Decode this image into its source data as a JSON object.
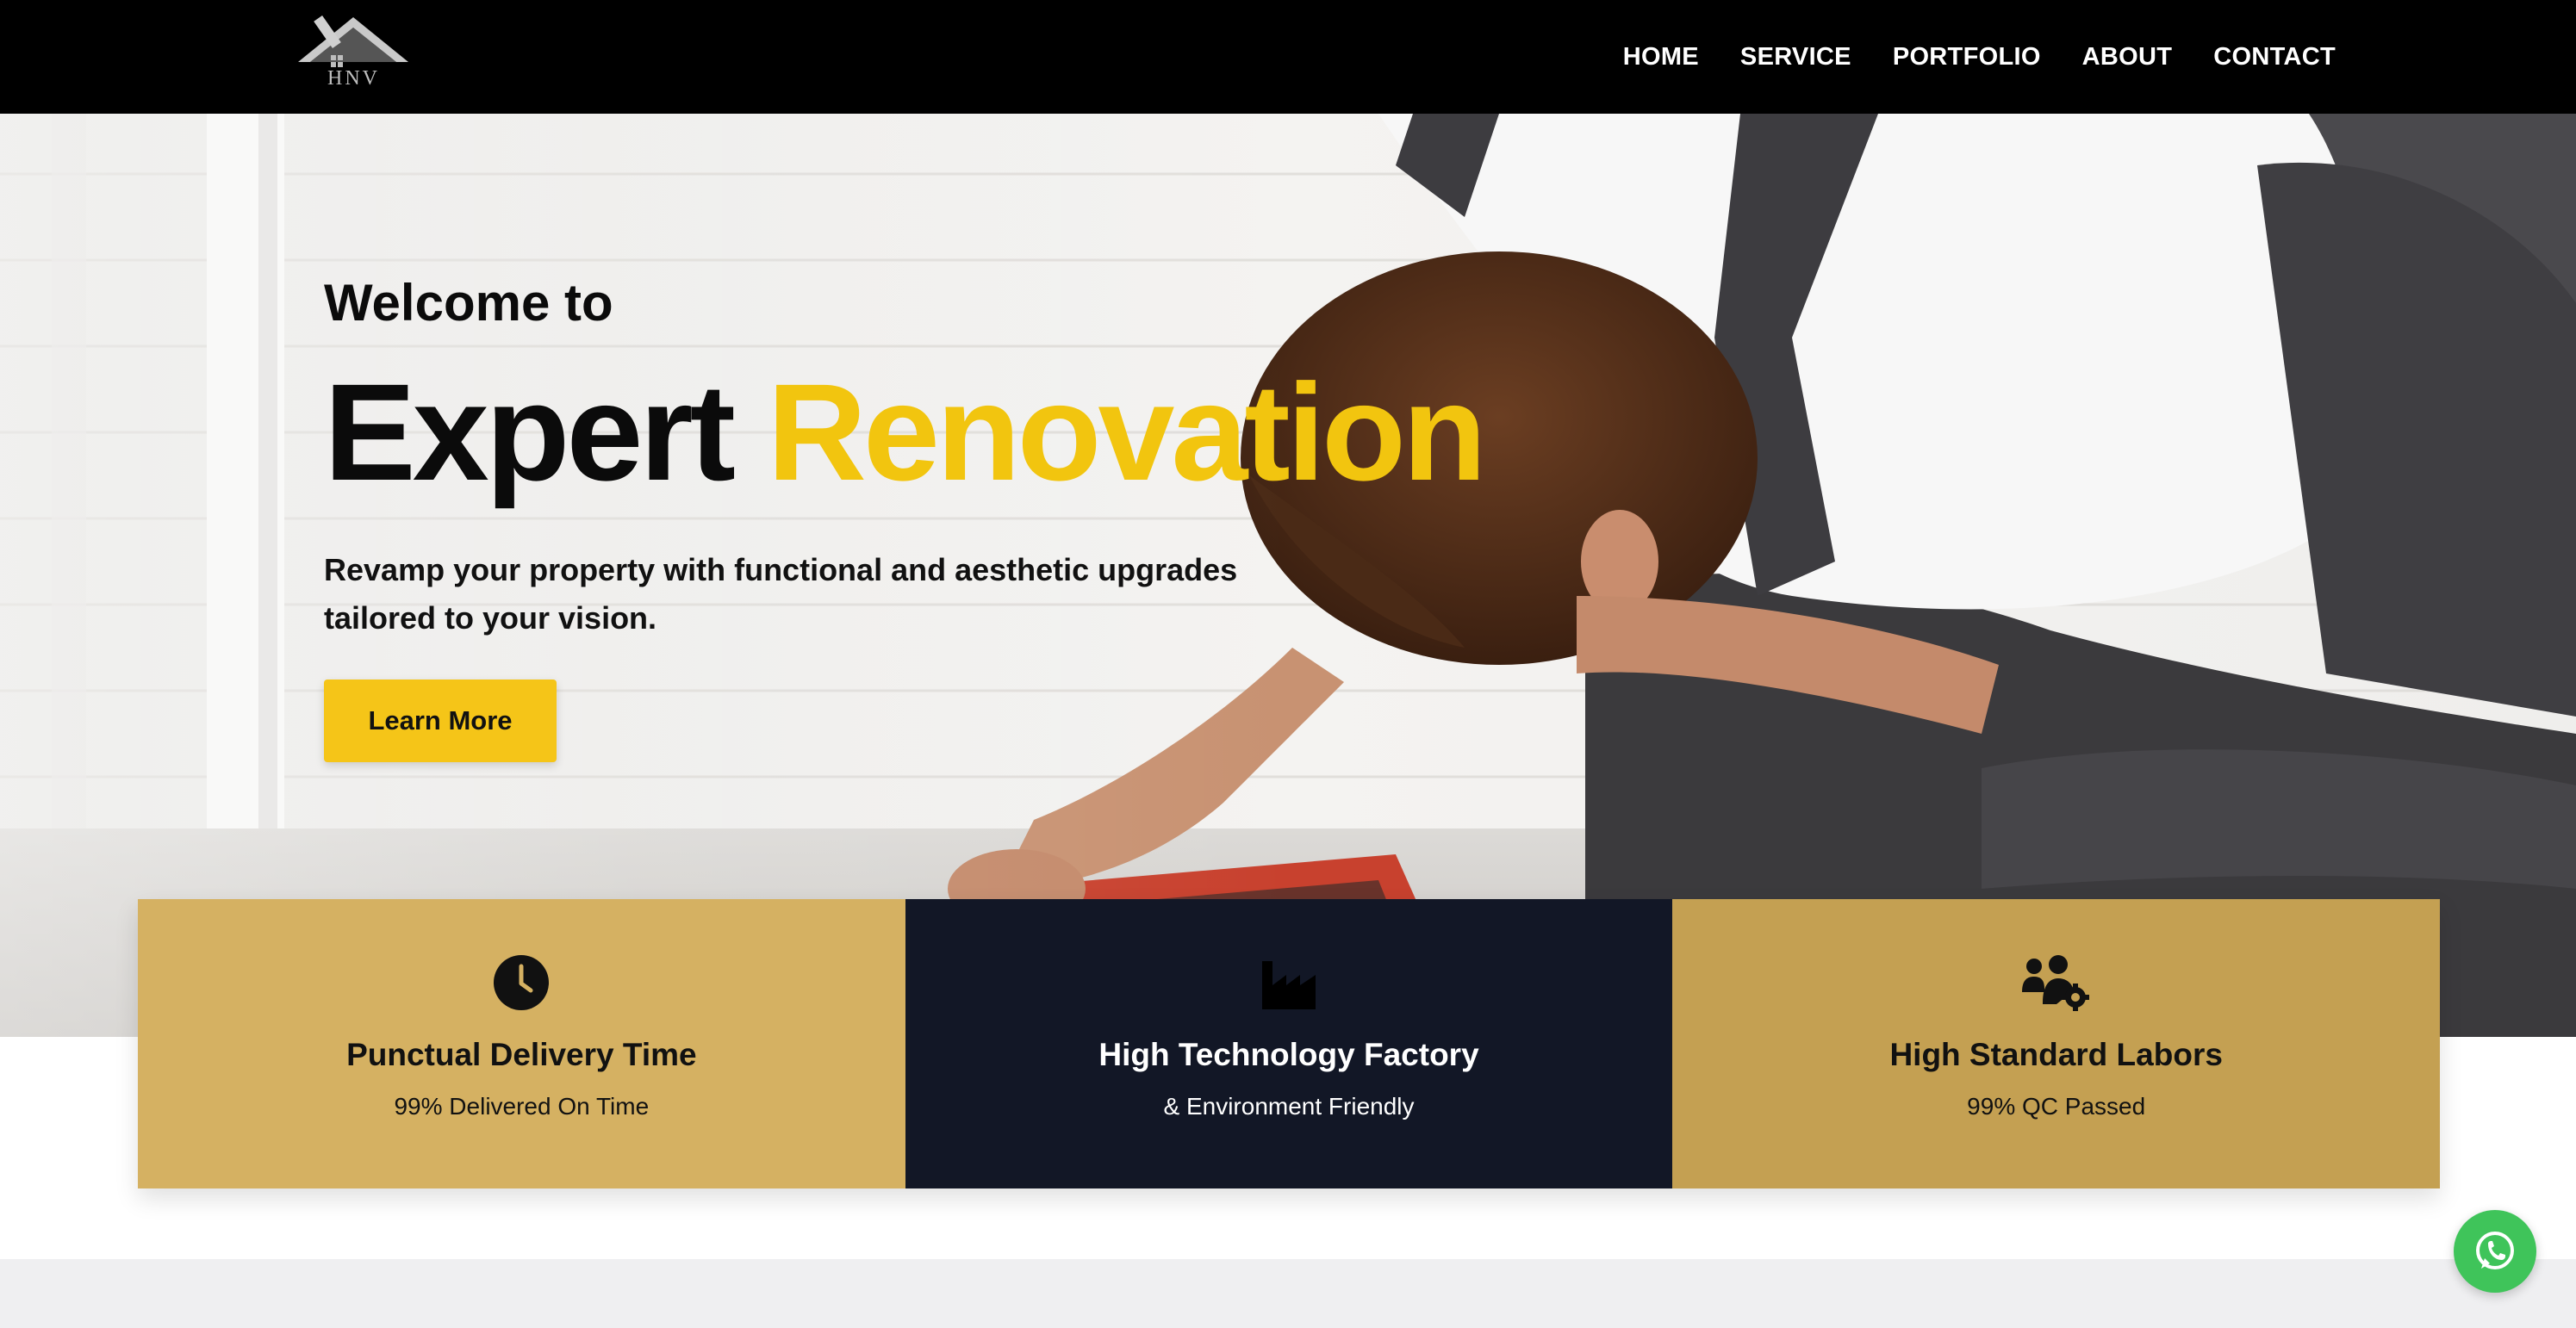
{
  "brand": {
    "logo_text": "HNV"
  },
  "nav": {
    "items": [
      {
        "label": "HOME"
      },
      {
        "label": "SERVICE"
      },
      {
        "label": "PORTFOLIO"
      },
      {
        "label": "ABOUT"
      },
      {
        "label": "CONTACT"
      }
    ]
  },
  "hero": {
    "welcome": "Welcome to",
    "title_part1": "Expert",
    "title_part2": "Renovation",
    "subtitle": "Revamp your property with functional and aesthetic upgrades tailored to your vision.",
    "button_label": "Learn More"
  },
  "features": [
    {
      "icon": "clock-icon",
      "title": "Punctual Delivery Time",
      "subtitle": "99% Delivered On Time",
      "bg_color": "#d5b162",
      "text_color": "#111111"
    },
    {
      "icon": "factory-icon",
      "title": "High Technology Factory",
      "subtitle": "& Environment Friendly",
      "bg_color": "#121726",
      "text_color": "#ffffff"
    },
    {
      "icon": "users-gear-icon",
      "title": "High Standard Labors",
      "subtitle": "99% QC Passed",
      "bg_color": "#c4a052",
      "text_color": "#111111"
    }
  ],
  "colors": {
    "accent_yellow": "#f2c50f",
    "button_yellow": "#f5c518",
    "navbar_bg": "#000000",
    "whatsapp_green": "#3fc45a"
  },
  "floating": {
    "whatsapp_icon": "whatsapp-icon"
  }
}
